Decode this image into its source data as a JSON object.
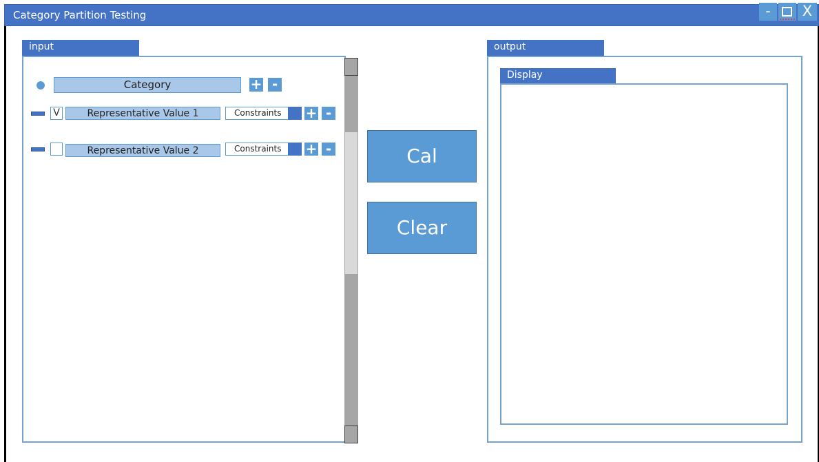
{
  "window": {
    "title": "Category Partition Testing",
    "controls": {
      "minimize": "-",
      "maximize": "",
      "close": "X"
    }
  },
  "input": {
    "tab_label": "input",
    "category": {
      "label": "Category",
      "add": "+",
      "remove": "-"
    },
    "values": [
      {
        "label": "Representative Value 1",
        "checked_mark": "V",
        "constraints": "Constraints",
        "add": "+",
        "remove": "-"
      },
      {
        "label": "Representative Value 2",
        "checked_mark": "",
        "constraints": "Constraints",
        "add": "+",
        "remove": "-"
      }
    ]
  },
  "actions": {
    "cal": "Cal",
    "clear": "Clear"
  },
  "output": {
    "tab_label": "output",
    "display_tab_label": "Display",
    "display_text": ""
  },
  "colors": {
    "titlebar": "#4472c4",
    "accent": "#5b9bd5",
    "field": "#a9c7e8",
    "panel_border": "#74a3d0"
  },
  "icons": {
    "category": "circle-icon",
    "value_row": "minus-bar-icon",
    "add": "plus-icon",
    "remove": "minus-icon"
  }
}
